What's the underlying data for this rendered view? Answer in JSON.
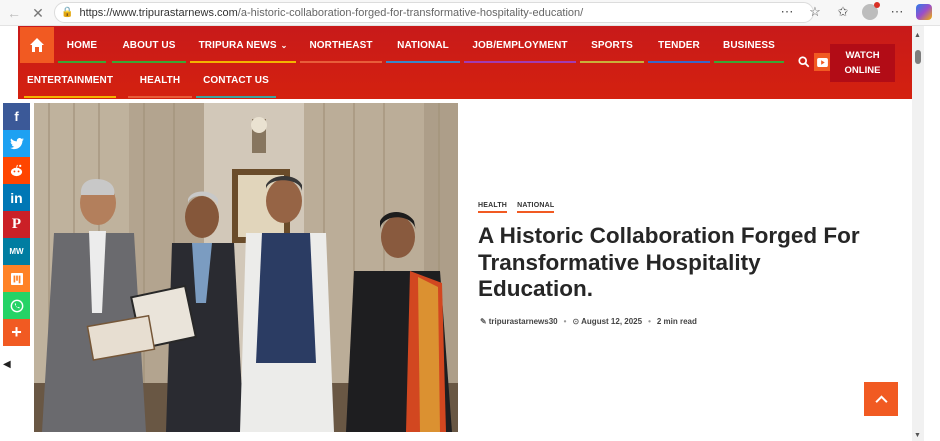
{
  "browser": {
    "url_host": "https://www.tripurastarnews.com",
    "url_path": "/a-historic-collaboration-forged-for-transformative-hospitality-education/"
  },
  "nav": {
    "row1": [
      {
        "label": "HOME",
        "color": "#3aa635"
      },
      {
        "label": "ABOUT US",
        "color": "#3aa635"
      },
      {
        "label": "TRIPURA NEWS",
        "color": "#f4b400",
        "has_dropdown": true
      },
      {
        "label": "NORTHEAST",
        "color": "#e85d3a"
      },
      {
        "label": "NATIONAL",
        "color": "#3a86c8"
      },
      {
        "label": "JOB/EMPLOYMENT",
        "color": "#a23bb3"
      },
      {
        "label": "SPORTS",
        "color": "#c9b03a"
      },
      {
        "label": "TENDER",
        "color": "#3a66c8"
      },
      {
        "label": "BUSINESS",
        "color": "#3aa635"
      }
    ],
    "row2": [
      {
        "label": "ENTERTAINMENT",
        "color": "#f4b400"
      },
      {
        "label": "HEALTH",
        "color": "#e85d3a"
      },
      {
        "label": "CONTACT US",
        "color": "#3aa6a0"
      }
    ],
    "watch_line1": "WATCH",
    "watch_line2": "ONLINE"
  },
  "share": [
    {
      "icon": "facebook-icon",
      "glyph": "f",
      "color": "#3b5998"
    },
    {
      "icon": "twitter-icon",
      "glyph": "🐦",
      "color": "#1da1f2"
    },
    {
      "icon": "reddit-icon",
      "glyph": "☻",
      "color": "#ff4500"
    },
    {
      "icon": "linkedin-icon",
      "glyph": "in",
      "color": "#0077b5"
    },
    {
      "icon": "pinterest-icon",
      "glyph": "P",
      "color": "#cb2027"
    },
    {
      "icon": "mewe-icon",
      "glyph": "MW",
      "color": "#007da1"
    },
    {
      "icon": "mix-icon",
      "glyph": "m",
      "color": "#ff8226"
    },
    {
      "icon": "whatsapp-icon",
      "glyph": "✆",
      "color": "#25d366"
    },
    {
      "icon": "more-icon",
      "glyph": "+",
      "color": "#f15a22"
    }
  ],
  "article": {
    "categories": [
      "HEALTH",
      "NATIONAL"
    ],
    "title": "A Historic Collaboration Forged For Transformative Hospitality Education.",
    "author": "tripurastarnews30",
    "date": "August 12, 2025",
    "read_time": "2 min read"
  }
}
